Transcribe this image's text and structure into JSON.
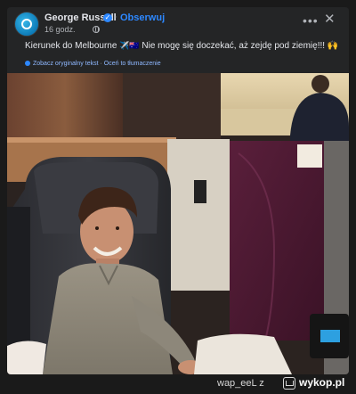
{
  "post": {
    "author": "George Russell",
    "follow_label": "Obserwuj",
    "time": "16 godz.",
    "text_part1": "Kierunek do Melbourne",
    "text_part2": "Nie mogę się doczekać, aż zejdę pod ziemię!!!",
    "translation_see_original": "Zobacz oryginalny tekst",
    "translation_rate": "Oceń to tłumaczenie"
  },
  "icons": {
    "verified": "verified-badge-icon",
    "globe": "globe-icon",
    "more": "more-options-icon",
    "close": "close-icon"
  },
  "watermark": {
    "user": "wap_eeL z",
    "site": "wykop.pl"
  },
  "colors": {
    "background": "#1a1a1a",
    "card": "#242526",
    "link_blue": "#2d88ff",
    "text_primary": "#e4e6eb",
    "text_secondary": "#b0b3b8"
  }
}
